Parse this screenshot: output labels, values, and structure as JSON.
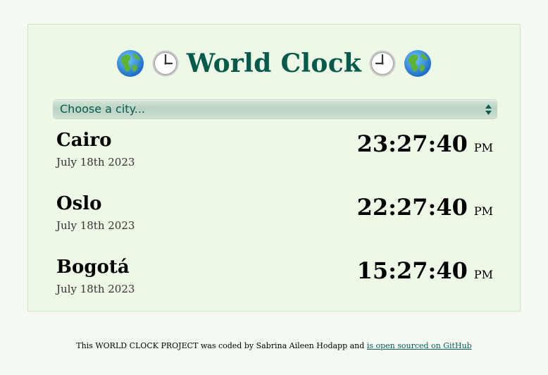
{
  "header": {
    "title": "World Clock",
    "icons": [
      "globe-americas-icon",
      "clock-three-icon",
      "clock-nine-icon",
      "globe-americas-icon"
    ]
  },
  "city_select": {
    "selected_label": "Choose a city...",
    "icon": "select-arrows-icon"
  },
  "cities": [
    {
      "name": "Cairo",
      "date": "July 18th 2023",
      "time": "23:27:40",
      "ampm": "PM"
    },
    {
      "name": "Oslo",
      "date": "July 18th 2023",
      "time": "22:27:40",
      "ampm": "PM"
    },
    {
      "name": "Bogotá",
      "date": "July 18th 2023",
      "time": "15:27:40",
      "ampm": "PM"
    }
  ],
  "footer": {
    "text": "This WORLD CLOCK PROJECT was coded by Sabrina Aileen Hodapp and ",
    "link_text": "is open sourced on GitHub"
  },
  "colors": {
    "page_background": "#f4f9f1",
    "card_background": "#eef8e6",
    "title_color": "#065a4c",
    "link_color": "#0b5d59"
  }
}
